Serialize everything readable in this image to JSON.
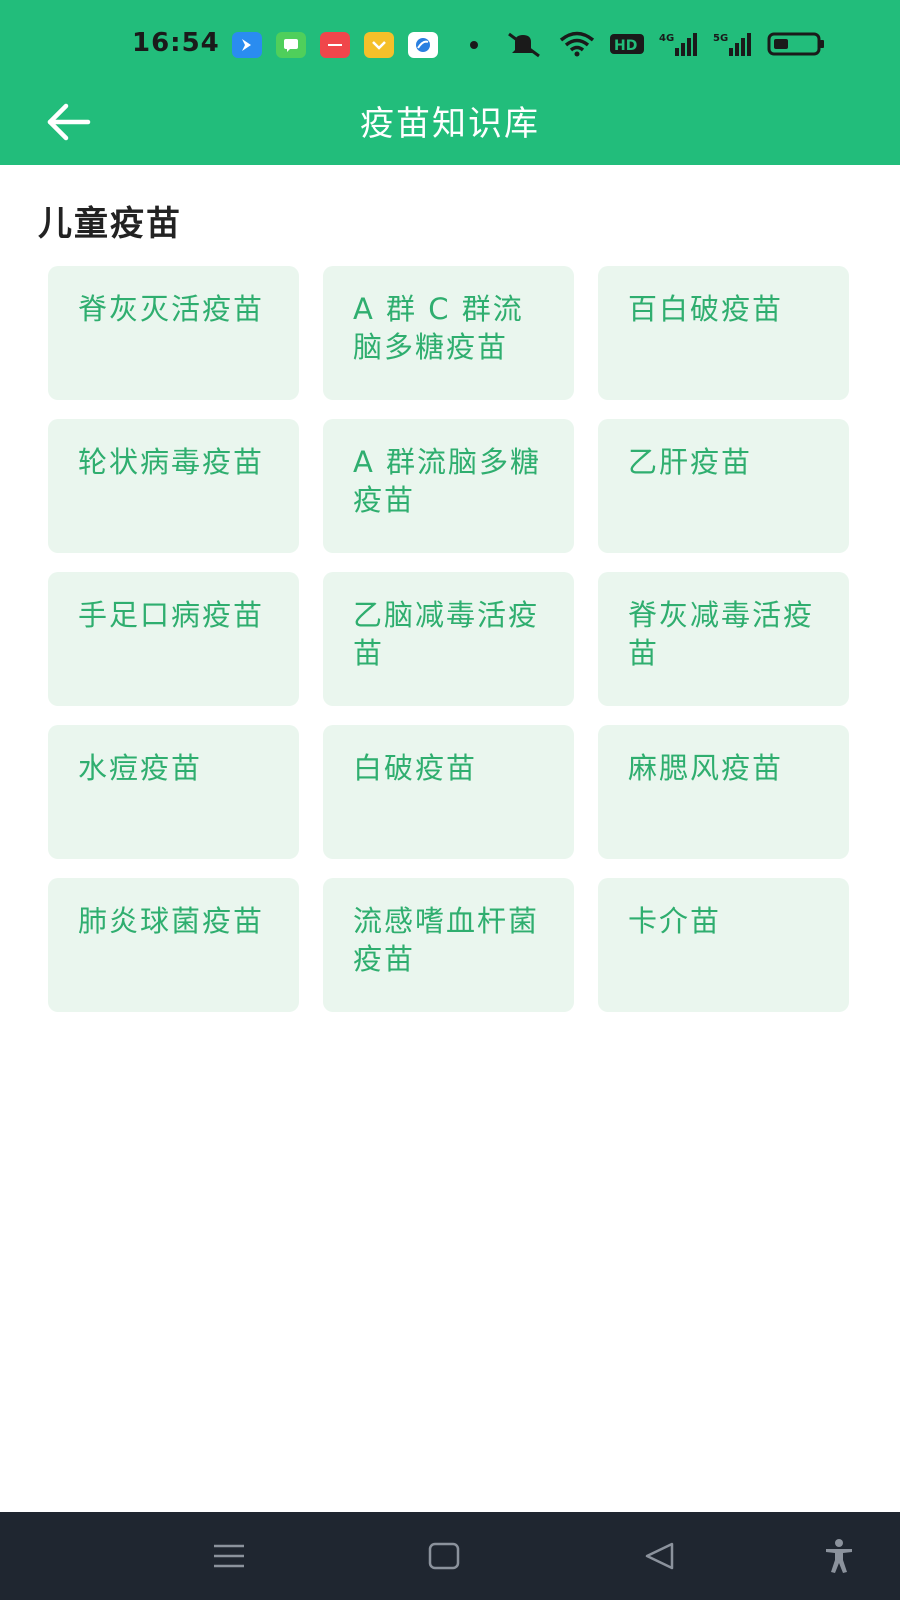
{
  "status_bar": {
    "time": "16:54",
    "network_labels": [
      "HD",
      "4G",
      "5G"
    ],
    "notification_icons": [
      "message-app-icon",
      "chat-app-icon",
      "shopping-app-icon",
      "coupon-app-icon",
      "browser-app-icon"
    ],
    "system_icons": [
      "mute-icon",
      "wifi-icon",
      "hd-badge-icon",
      "signal-4g-icon",
      "signal-5g-icon",
      "battery-icon"
    ]
  },
  "header": {
    "title": "疫苗知识库",
    "back_icon": "arrow-left-icon"
  },
  "section": {
    "title": "儿童疫苗",
    "items": [
      {
        "label": "脊灰灭活疫苗"
      },
      {
        "label": "A 群 C 群流脑多糖疫苗"
      },
      {
        "label": "百白破疫苗"
      },
      {
        "label": "轮状病毒疫苗"
      },
      {
        "label": "A 群流脑多糖疫苗"
      },
      {
        "label": "乙肝疫苗"
      },
      {
        "label": "手足口病疫苗"
      },
      {
        "label": "乙脑减毒活疫苗"
      },
      {
        "label": "脊灰减毒活疫苗"
      },
      {
        "label": "水痘疫苗"
      },
      {
        "label": "白破疫苗"
      },
      {
        "label": "麻腮风疫苗"
      },
      {
        "label": "肺炎球菌疫苗"
      },
      {
        "label": "流感嗜血杆菌疫苗"
      },
      {
        "label": "卡介苗"
      }
    ]
  },
  "nav_bar": {
    "icons": [
      "menu-icon",
      "home-icon",
      "back-triangle-icon",
      "accessibility-icon"
    ]
  },
  "colors": {
    "primary": "#22bd7b",
    "card_bg": "#eaf6ee",
    "card_text": "#2fae6f",
    "nav_bg": "#1f2630"
  }
}
